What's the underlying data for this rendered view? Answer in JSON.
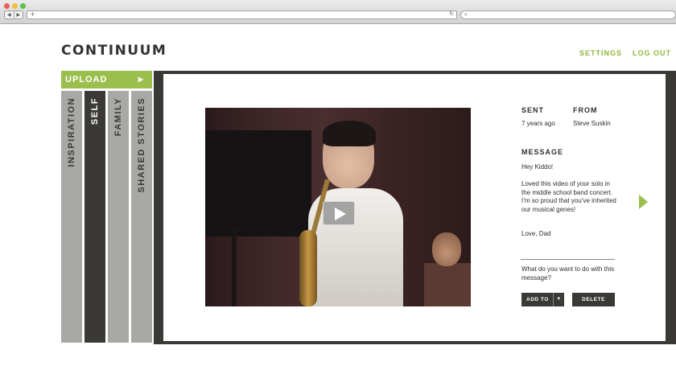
{
  "browser": {
    "back_glyph": "◀",
    "forward_glyph": "▶",
    "new_tab_glyph": "+",
    "reload_glyph": "↻",
    "search_glyph": "⌕"
  },
  "header": {
    "logo": "CONTINUUM",
    "settings": "SETTINGS",
    "logout": "LOG OUT"
  },
  "upload": {
    "label": "UPLOAD",
    "arrow": "▶"
  },
  "tabs": [
    {
      "label": "INSPIRATION",
      "active": false
    },
    {
      "label": "SELF",
      "active": true
    },
    {
      "label": "FAMILY",
      "active": false
    },
    {
      "label": "SHARED STORIES",
      "active": false
    }
  ],
  "message": {
    "sent_label": "SENT",
    "sent_value": "7 years ago",
    "from_label": "FROM",
    "from_value": "Steve Suskin",
    "message_label": "MESSAGE",
    "greeting": "Hey Kiddo!",
    "body": "Loved this video of your solo in the middle school band concert. I’m so proud that you’ve inherited our musical genes!",
    "signoff": "Love, Dad",
    "prompt": "What do you want to do with this message?",
    "add_to": "ADD TO",
    "add_to_caret": "▼",
    "delete": "DELETE"
  },
  "colors": {
    "accent": "#9bbf4c",
    "dark": "#3a3935",
    "tab_inactive": "#a8a9a5"
  },
  "icons": {
    "play": "play-icon",
    "next": "next-arrow-icon"
  }
}
